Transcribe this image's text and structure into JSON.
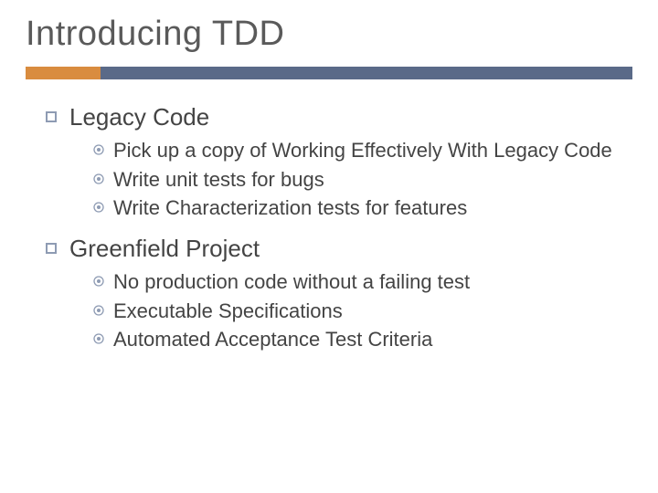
{
  "title": "Introducing TDD",
  "sections": [
    {
      "heading": "Legacy Code",
      "items": [
        "Pick up a copy of Working Effectively With Legacy Code",
        "Write unit tests for bugs",
        "Write Characterization tests for features"
      ]
    },
    {
      "heading": "Greenfield Project",
      "items": [
        "No production code without a failing test",
        "Executable Specifications",
        "Automated Acceptance Test Criteria"
      ]
    }
  ]
}
